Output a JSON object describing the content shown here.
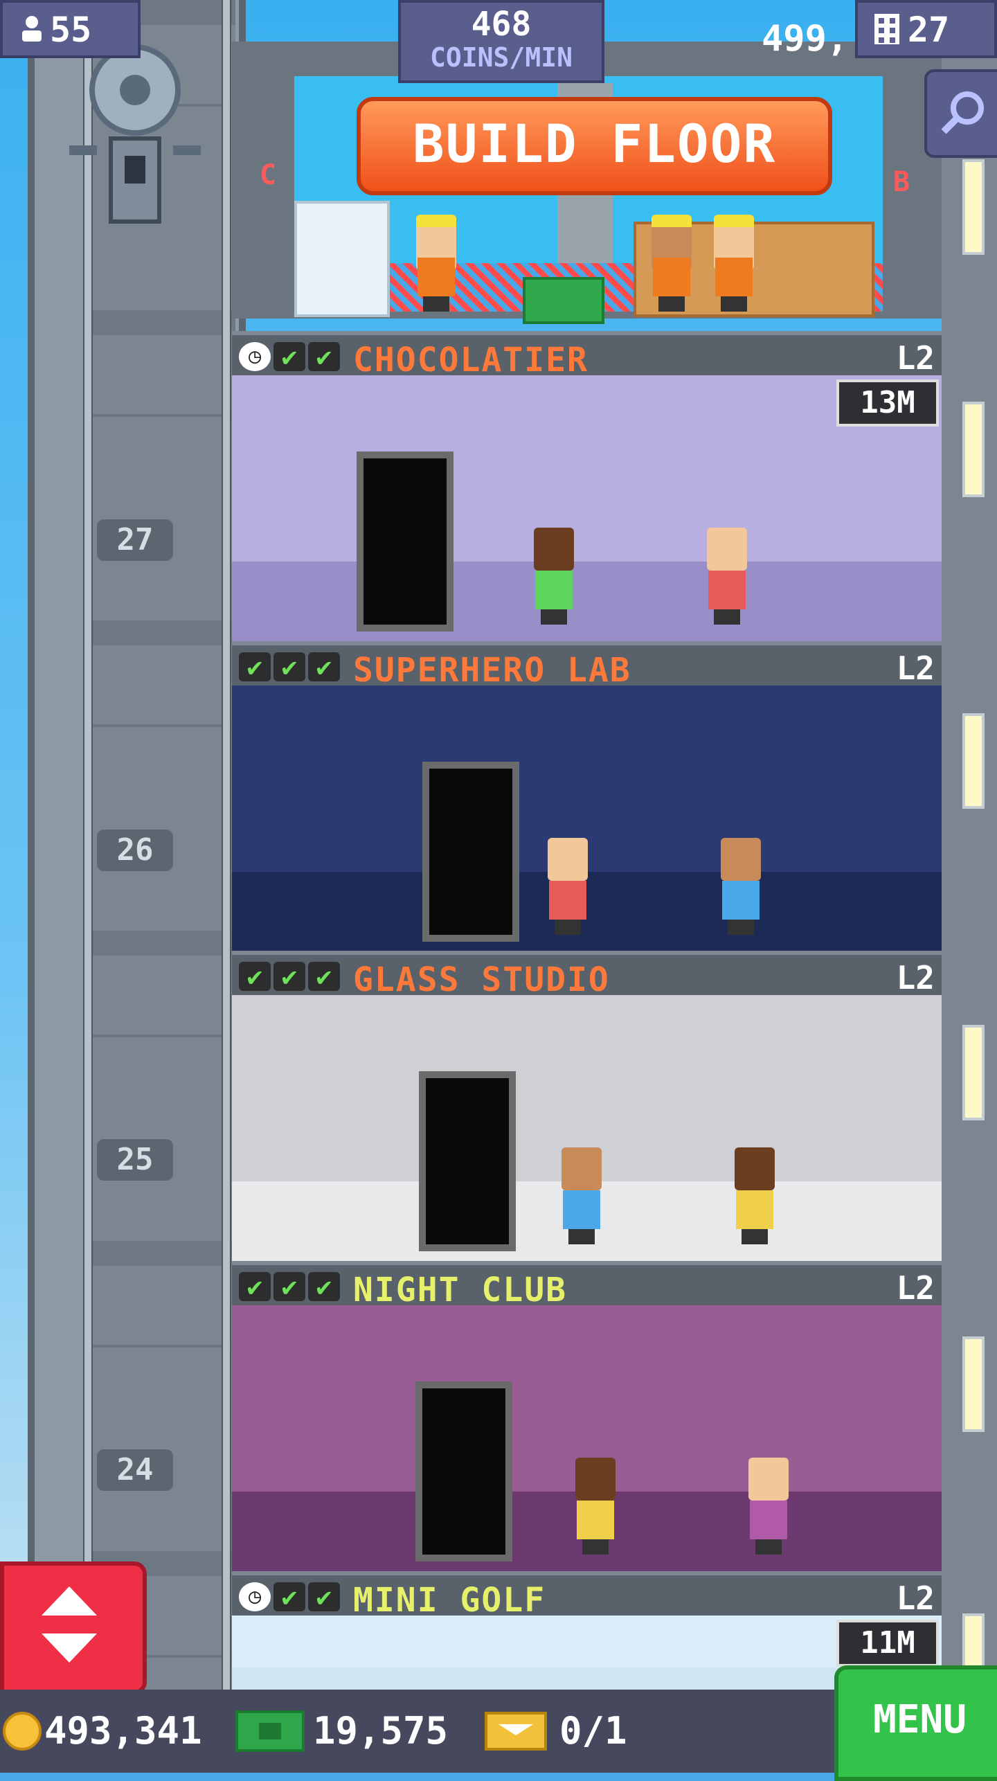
{
  "hud": {
    "population": "55",
    "coins_per_min_value": "468",
    "coins_per_min_label": "COINS/MIN",
    "progress_text": "499,",
    "floors": "27"
  },
  "build": {
    "label": "BUILD FLOOR",
    "left_letter": "C",
    "right_letter": "B"
  },
  "floors": [
    {
      "name": "CHOCOLATIER",
      "level": "L2",
      "timer": "13M",
      "has_clock": true,
      "checks": 2,
      "label_color": "#ff7a3a"
    },
    {
      "name": "SUPERHERO LAB",
      "level": "L2",
      "timer": "",
      "has_clock": false,
      "checks": 3,
      "label_color": "#ff7a3a"
    },
    {
      "name": "GLASS STUDIO",
      "level": "L2",
      "timer": "",
      "has_clock": false,
      "checks": 3,
      "label_color": "#ff7a3a"
    },
    {
      "name": "NIGHT CLUB",
      "level": "L2",
      "timer": "",
      "has_clock": false,
      "checks": 3,
      "label_color": "#e6f06a"
    },
    {
      "name": "MINI GOLF",
      "level": "L2",
      "timer": "11M",
      "has_clock": true,
      "checks": 2,
      "label_color": "#e6f06a"
    }
  ],
  "elevator": {
    "floor_numbers": [
      "27",
      "26",
      "25",
      "24"
    ]
  },
  "bottom": {
    "coins": "493,341",
    "bux": "19,575",
    "tickets": "0/1",
    "menu": "MENU"
  },
  "colors": {
    "accent_orange": "#ff7a3a",
    "accent_yellow": "#e6f06a",
    "menu_green": "#34c34a",
    "elevator_red": "#ee2f46"
  },
  "icons": [
    "person-icon",
    "floors-icon",
    "search-icon",
    "coin-icon",
    "bux-icon",
    "ticket-icon",
    "clock-icon",
    "check-icon",
    "up-down-arrows-icon"
  ]
}
